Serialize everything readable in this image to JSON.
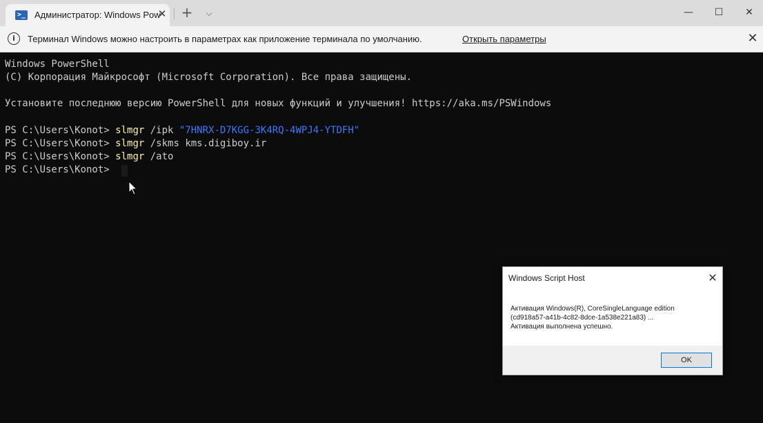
{
  "tab": {
    "icon": "powershell-icon",
    "title": "Администратор: Windows Pow",
    "close": "✕"
  },
  "titlebar": {
    "new_tab": "+",
    "dropdown": "⌵",
    "minimize": "—",
    "maximize": "☐",
    "close": "✕"
  },
  "infobar": {
    "icon": "info-icon",
    "message": "Терминал Windows можно настроить в параметрах как приложение терминала по умолчанию.",
    "link": "Открыть параметры",
    "close": "✕"
  },
  "terminal": {
    "line1": "Windows PowerShell",
    "line2": "(C) Корпорация Майкрософт (Microsoft Corporation). Все права защищены.",
    "line3": "Установите последнюю версию PowerShell для новых функций и улучшения! https://aka.ms/PSWindows",
    "prompt": "PS C:\\Users\\Konot> ",
    "cmd1": {
      "name": "slmgr",
      "args": " /ipk ",
      "key": "\"7HNRX-D7KGG-3K4RQ-4WPJ4-YTDFH\""
    },
    "cmd2": {
      "name": "slmgr",
      "args": " /skms kms.digiboy.ir"
    },
    "cmd3": {
      "name": "slmgr",
      "args": " /ato"
    }
  },
  "dialog": {
    "title": "Windows Script Host",
    "close": "✕",
    "message_line1": "Активация Windows(R), CoreSingleLanguage edition",
    "message_line2": "(cd918a57-a41b-4c82-8dce-1a538e221a83) ...",
    "message_line3": "Активация выполнена успешно.",
    "ok": "OK"
  },
  "colors": {
    "terminal_bg": "#0c0c0c",
    "terminal_fg": "#cccccc",
    "command": "#f9f1a5",
    "string": "#3b78ff"
  }
}
